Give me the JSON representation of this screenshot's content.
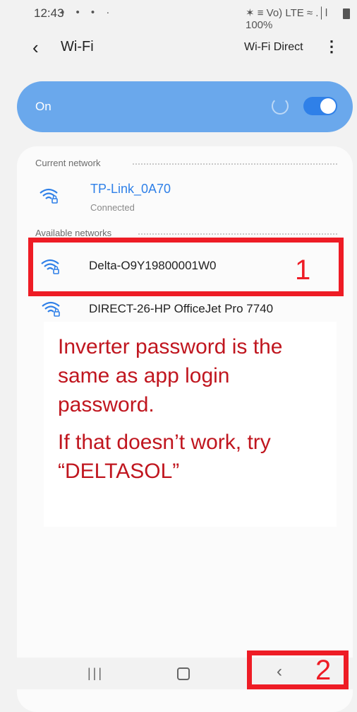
{
  "status_bar": {
    "time": "12:43",
    "left_icons": "▪ • • ·",
    "right_icons": "✶ ≡ Vo) LTE ≈ .│l",
    "battery": "100%"
  },
  "header": {
    "title": "Wi-Fi",
    "wifi_direct_label": "Wi-Fi Direct"
  },
  "toggle": {
    "label": "On",
    "state": "on"
  },
  "current_network": {
    "section_label": "Current network",
    "name": "TP-Link_0A70",
    "status": "Connected"
  },
  "available_networks": {
    "section_label": "Available networks",
    "items": [
      {
        "name": "Delta-O9Y19800001W0"
      },
      {
        "name": "DIRECT-26-HP OfficeJet Pro 7740"
      }
    ]
  },
  "annotations": {
    "marker_1": "1",
    "marker_2": "2",
    "callout_line_1": "Inverter password is the same as app login password.",
    "callout_line_2": "If that doesn’t work, try “DELTASOL”"
  },
  "colors": {
    "accent": "#2f80e8",
    "toggle_card": "#6aa8ec",
    "annotation_red": "#ee1c25",
    "callout_text": "#c0161f"
  }
}
